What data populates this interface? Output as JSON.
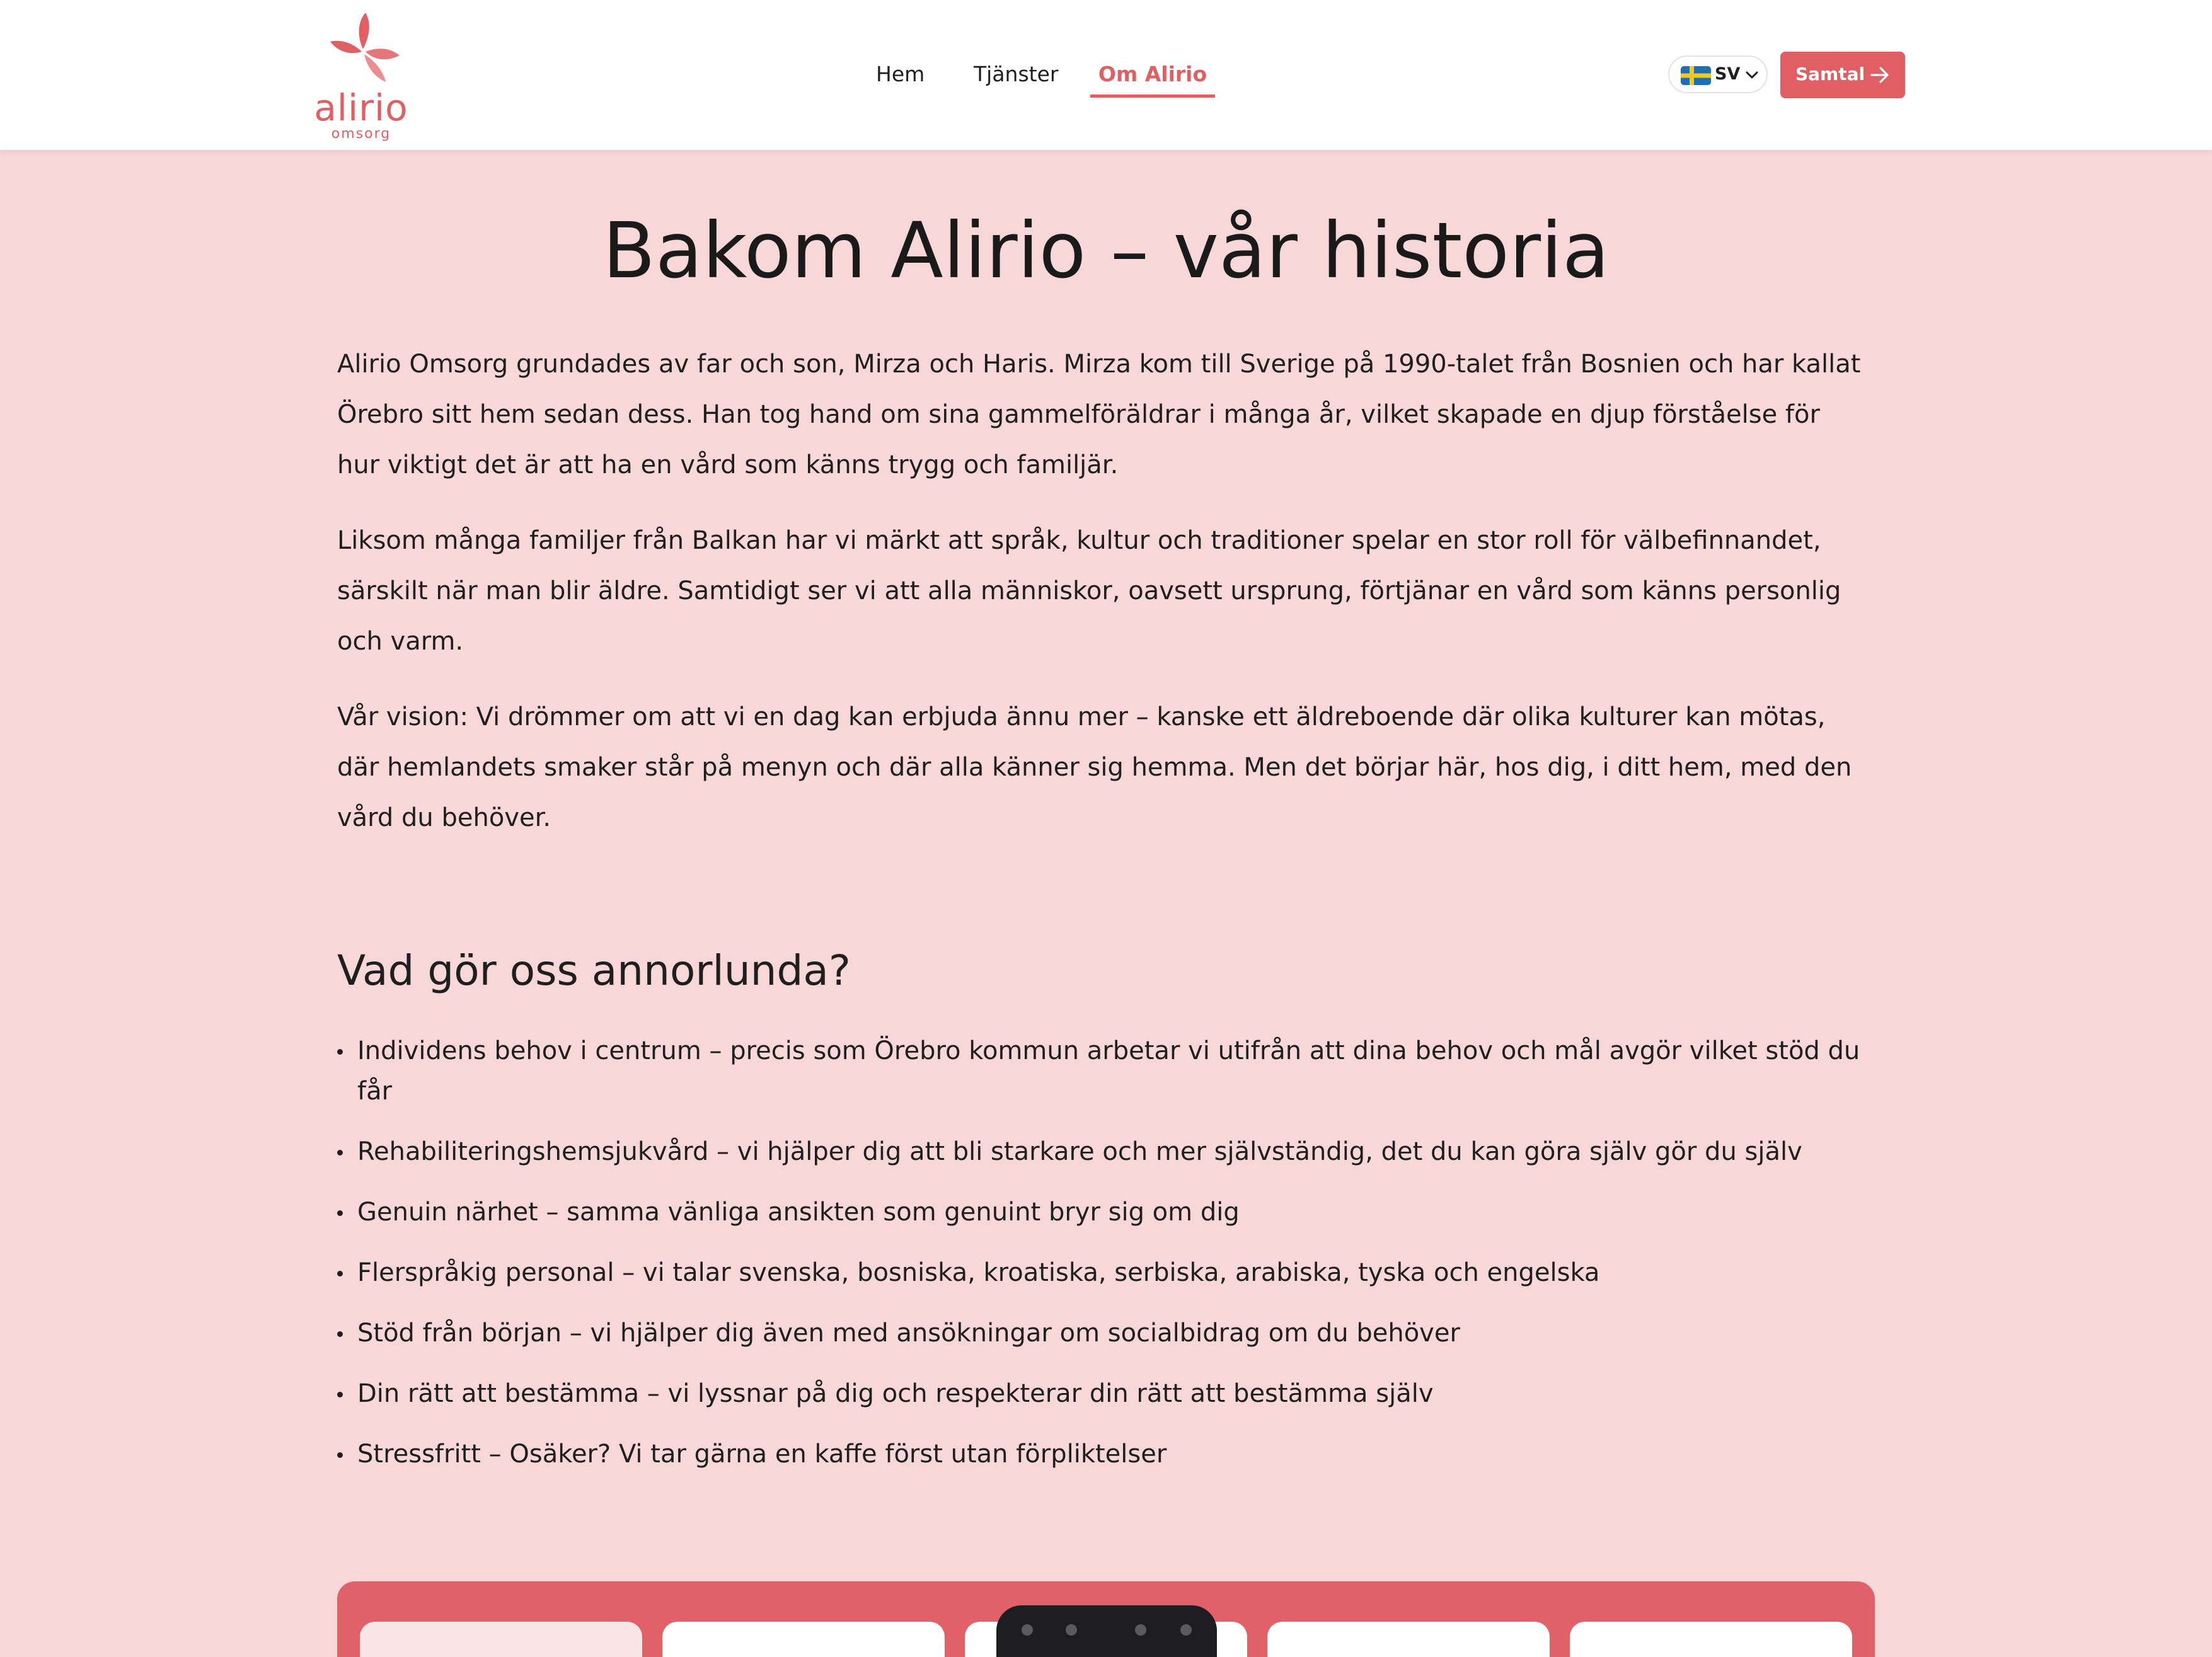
{
  "brand": {
    "name": "alirio",
    "tagline": "omsorg",
    "color": "#e05f63"
  },
  "nav": {
    "items": [
      {
        "label": "Hem",
        "active": false
      },
      {
        "label": "Tjänster",
        "active": false
      },
      {
        "label": "Om Alirio",
        "active": true
      }
    ]
  },
  "language": {
    "code": "SV",
    "flag": "sweden-flag-icon"
  },
  "cta": {
    "label": "Samtal",
    "icon": "arrow-right-icon"
  },
  "main": {
    "title": "Bakom Alirio – vår historia",
    "paragraphs": [
      "Alirio Omsorg grundades av far och son, Mirza och Haris. Mirza kom till Sverige på 1990-talet från Bosnien och har kallat Örebro sitt hem sedan dess. Han tog hand om sina gammelföräldrar i många år, vilket skapade en djup förståelse för hur viktigt det är att ha en vård som känns trygg och familjär.",
      "Liksom många familjer från Balkan har vi märkt att språk, kultur och traditioner spelar en stor roll för välbefinnandet, särskilt när man blir äldre. Samtidigt ser vi att alla människor, oavsett ursprung, förtjänar en vård som känns personlig och varm.",
      "Vår vision: Vi drömmer om att vi en dag kan erbjuda ännu mer – kanske ett äldreboende där olika kulturer kan mötas, där hemlandets smaker står på menyn och där alla känner sig hemma. Men det börjar här, hos dig, i ditt hem, med den vård du behöver."
    ],
    "section_title": "Vad gör oss annorlunda?",
    "features": [
      "Individens behov i centrum – precis som Örebro kommun arbetar vi utifrån att dina behov och mål avgör vilket stöd du får",
      "Rehabiliteringshemsjukvård – vi hjälper dig att bli starkare och mer självständig, det du kan göra själv gör du själv",
      "Genuin närhet – samma vänliga ansikten som genuint bryr sig om dig",
      "Flerspråkig personal – vi talar svenska, bosniska, kroatiska, serbiska, arabiska, tyska och engelska",
      "Stöd från början – vi hjälper dig även med ansökningar om socialbidrag om du behöver",
      "Din rätt att bestämma – vi lyssnar på dig och respekterar din rätt att bestämma själv",
      "Stressfritt – Osäker? Vi tar gärna en kaffe först utan förpliktelser"
    ]
  },
  "colors": {
    "page_background": "#f7d7d8",
    "accent": "#e05f63",
    "card_strip": "#e06268"
  }
}
